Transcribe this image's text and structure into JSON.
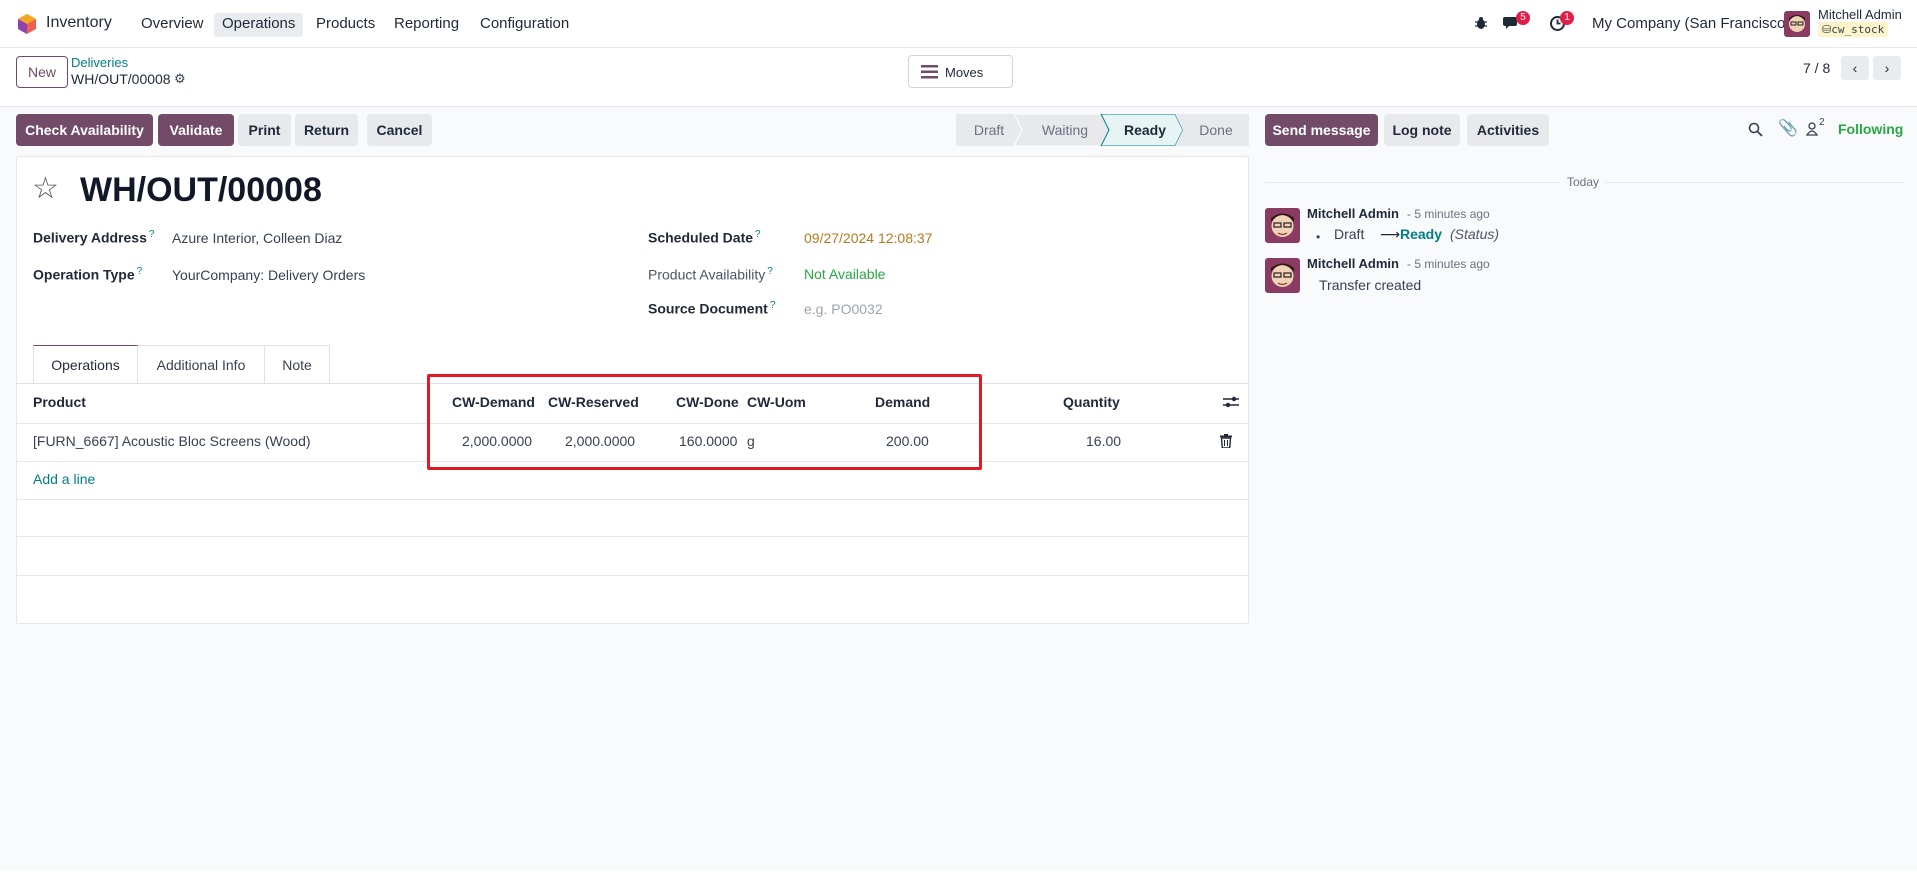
{
  "navbar": {
    "app_name": "Inventory",
    "menu": [
      "Overview",
      "Operations",
      "Products",
      "Reporting",
      "Configuration"
    ],
    "active_menu": "Operations",
    "messages_count": "5",
    "activities_count": "1",
    "company": "My Company (San Francisco)",
    "user_name": "Mitchell Admin",
    "db_name": "cw_stock"
  },
  "control": {
    "new_label": "New",
    "breadcrumb_parent": "Deliveries",
    "breadcrumb_current": "WH/OUT/00008",
    "moves_label": "Moves",
    "pager": "7 / 8"
  },
  "actions": {
    "check_availability": "Check Availability",
    "validate": "Validate",
    "print": "Print",
    "return": "Return",
    "cancel": "Cancel"
  },
  "status": {
    "stages": [
      "Draft",
      "Waiting",
      "Ready",
      "Done"
    ],
    "current": "Ready"
  },
  "form": {
    "title": "WH/OUT/00008",
    "delivery_address_label": "Delivery Address",
    "delivery_address": "Azure Interior, Colleen Diaz",
    "operation_type_label": "Operation Type",
    "operation_type": "YourCompany: Delivery Orders",
    "scheduled_date_label": "Scheduled Date",
    "scheduled_date": "09/27/2024 12:08:37",
    "product_availability_label": "Product Availability",
    "product_availability": "Not Available",
    "source_document_label": "Source Document",
    "source_document_placeholder": "e.g. PO0032",
    "tabs": [
      "Operations",
      "Additional Info",
      "Note"
    ]
  },
  "table": {
    "headers": {
      "product": "Product",
      "cw_demand": "CW-Demand",
      "cw_reserved": "CW-Reserved",
      "cw_done": "CW-Done",
      "cw_uom": "CW-Uom",
      "demand": "Demand",
      "quantity": "Quantity"
    },
    "rows": [
      {
        "product": "[FURN_6667] Acoustic Bloc Screens (Wood)",
        "cw_demand": "2,000.0000",
        "cw_reserved": "2,000.0000",
        "cw_done": "160.0000",
        "cw_uom": "g",
        "demand": "200.00",
        "quantity": "16.00"
      }
    ],
    "add_line": "Add a line"
  },
  "chatter": {
    "send_message": "Send message",
    "log_note": "Log note",
    "activities": "Activities",
    "followers_count": "2",
    "following": "Following",
    "today": "Today",
    "messages": [
      {
        "author": "Mitchell Admin",
        "time": "- 5 minutes ago",
        "from": "Draft",
        "arrow": "⟶",
        "to": "Ready",
        "field": "(Status)"
      },
      {
        "author": "Mitchell Admin",
        "time": "- 5 minutes ago",
        "body": "Transfer created"
      }
    ]
  },
  "colors": {
    "primary": "#714b67",
    "link": "#017e84",
    "date": "#b7791f",
    "not_available": "#28a745",
    "highlight": "#e01b24"
  }
}
